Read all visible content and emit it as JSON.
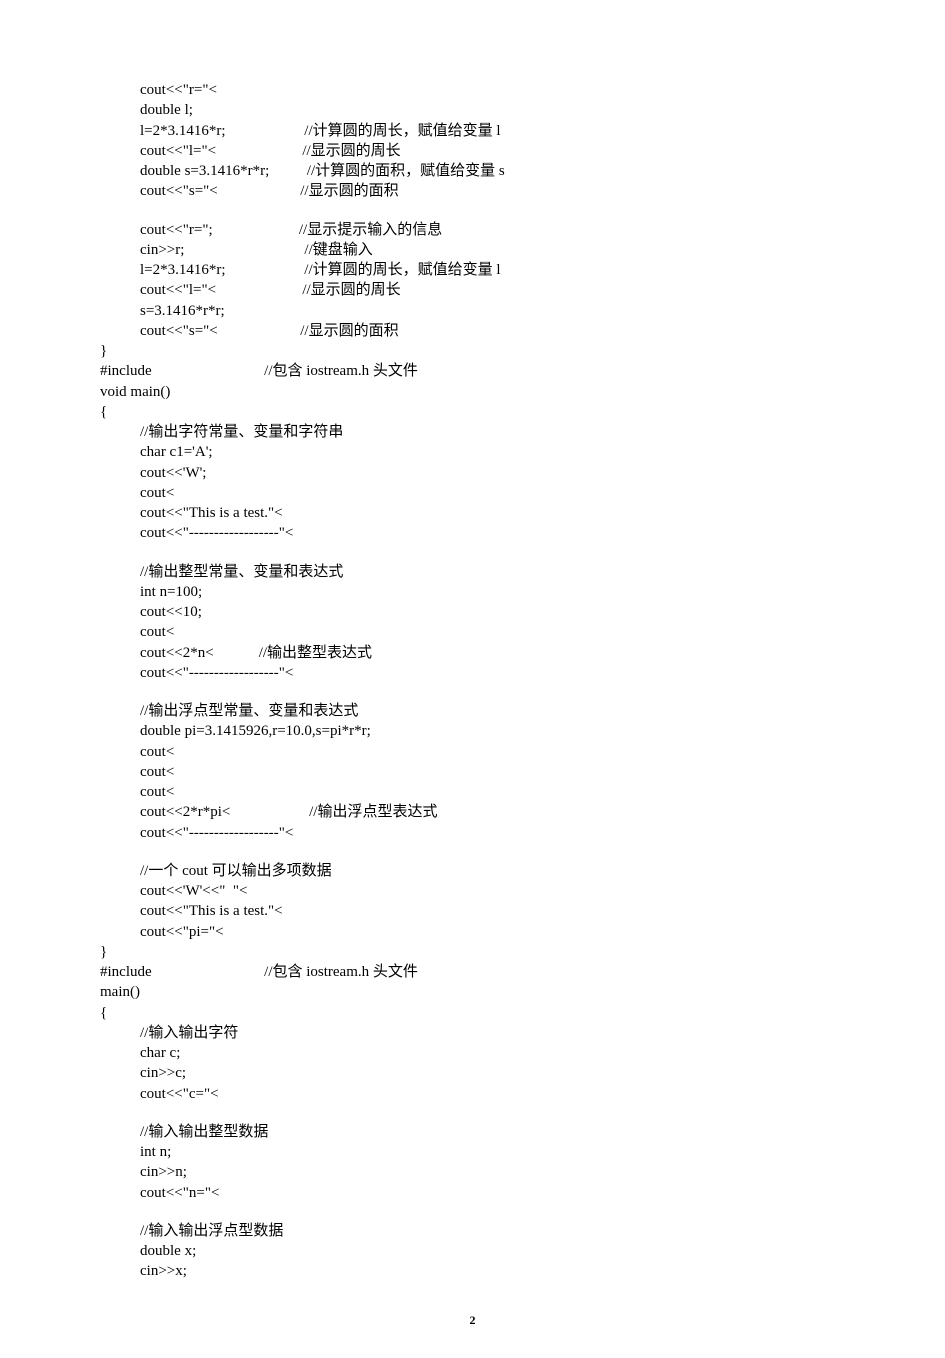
{
  "pageNumber": "2",
  "lines": [
    {
      "indent": 1,
      "text": "cout<<\"r=\"<"
    },
    {
      "indent": 1,
      "text": "double l;"
    },
    {
      "indent": 1,
      "text": "l=2*3.1416*r;                     //计算圆的周长，赋值给变量 l"
    },
    {
      "indent": 1,
      "text": "cout<<\"l=\"<                       //显示圆的周长"
    },
    {
      "indent": 1,
      "text": "double s=3.1416*r*r;          //计算圆的面积，赋值给变量 s"
    },
    {
      "indent": 1,
      "text": "cout<<\"s=\"<                      //显示圆的面积"
    },
    {
      "indent": 1,
      "blank": true
    },
    {
      "indent": 1,
      "text": "cout<<\"r=\";                       //显示提示输入的信息"
    },
    {
      "indent": 1,
      "text": "cin>>r;                                //键盘输入"
    },
    {
      "indent": 1,
      "text": "l=2*3.1416*r;                     //计算圆的周长，赋值给变量 l"
    },
    {
      "indent": 1,
      "text": "cout<<\"l=\"<                       //显示圆的周长"
    },
    {
      "indent": 1,
      "text": "s=3.1416*r*r;"
    },
    {
      "indent": 1,
      "text": "cout<<\"s=\"<                      //显示圆的面积"
    },
    {
      "indent": 0,
      "text": "}"
    },
    {
      "indent": 0,
      "text": "#include                              //包含 iostream.h 头文件"
    },
    {
      "indent": 0,
      "text": "void main()"
    },
    {
      "indent": 0,
      "text": "{"
    },
    {
      "indent": 1,
      "text": "//输出字符常量、变量和字符串"
    },
    {
      "indent": 1,
      "text": "char c1='A';"
    },
    {
      "indent": 1,
      "text": "cout<<'W';"
    },
    {
      "indent": 1,
      "text": "cout<"
    },
    {
      "indent": 1,
      "text": "cout<<\"This is a test.\"<"
    },
    {
      "indent": 1,
      "text": "cout<<\"------------------\"<"
    },
    {
      "indent": 1,
      "blank": true
    },
    {
      "indent": 1,
      "text": "//输出整型常量、变量和表达式"
    },
    {
      "indent": 1,
      "text": "int n=100;"
    },
    {
      "indent": 1,
      "text": "cout<<10;"
    },
    {
      "indent": 1,
      "text": "cout<"
    },
    {
      "indent": 1,
      "text": "cout<<2*n<            //输出整型表达式"
    },
    {
      "indent": 1,
      "text": "cout<<\"------------------\"<"
    },
    {
      "indent": 1,
      "blank": true
    },
    {
      "indent": 1,
      "text": "//输出浮点型常量、变量和表达式"
    },
    {
      "indent": 1,
      "text": "double pi=3.1415926,r=10.0,s=pi*r*r;"
    },
    {
      "indent": 1,
      "text": "cout<"
    },
    {
      "indent": 1,
      "text": "cout<"
    },
    {
      "indent": 1,
      "text": "cout<"
    },
    {
      "indent": 1,
      "text": "cout<<2*r*pi<                     //输出浮点型表达式"
    },
    {
      "indent": 1,
      "text": "cout<<\"------------------\"<"
    },
    {
      "indent": 1,
      "blank": true
    },
    {
      "indent": 1,
      "text": "//一个 cout 可以输出多项数据"
    },
    {
      "indent": 1,
      "text": "cout<<'W'<<\"  \"<"
    },
    {
      "indent": 1,
      "text": "cout<<\"This is a test.\"<"
    },
    {
      "indent": 1,
      "text": "cout<<\"pi=\"<"
    },
    {
      "indent": 0,
      "text": "}"
    },
    {
      "indent": 0,
      "text": "#include                              //包含 iostream.h 头文件"
    },
    {
      "indent": 0,
      "text": "main()"
    },
    {
      "indent": 0,
      "text": "{"
    },
    {
      "indent": 1,
      "text": "//输入输出字符"
    },
    {
      "indent": 1,
      "text": "char c;"
    },
    {
      "indent": 1,
      "text": "cin>>c;"
    },
    {
      "indent": 1,
      "text": "cout<<\"c=\"<"
    },
    {
      "indent": 1,
      "blank": true
    },
    {
      "indent": 1,
      "text": "//输入输出整型数据"
    },
    {
      "indent": 1,
      "text": "int n;"
    },
    {
      "indent": 1,
      "text": "cin>>n;"
    },
    {
      "indent": 1,
      "text": "cout<<\"n=\"<"
    },
    {
      "indent": 1,
      "blank": true
    },
    {
      "indent": 1,
      "text": "//输入输出浮点型数据"
    },
    {
      "indent": 1,
      "text": "double x;"
    },
    {
      "indent": 1,
      "text": "cin>>x;"
    }
  ]
}
